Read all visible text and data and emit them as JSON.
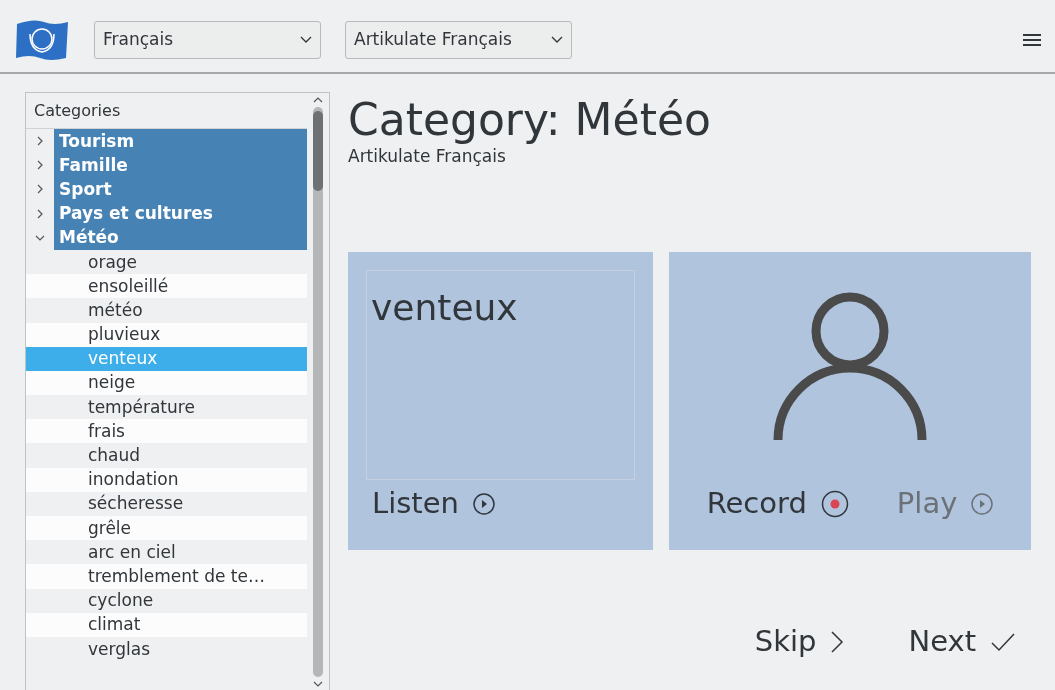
{
  "toolbar": {
    "language_select": {
      "value": "Français"
    },
    "course_select": {
      "value": "Artikulate Français"
    }
  },
  "categories": {
    "header": "Categories",
    "items": [
      {
        "label": "Tourism",
        "expanded": false
      },
      {
        "label": "Famille",
        "expanded": false
      },
      {
        "label": "Sport",
        "expanded": false
      },
      {
        "label": "Pays et cultures",
        "expanded": false
      },
      {
        "label": "Météo",
        "expanded": true,
        "children": [
          {
            "label": "orage",
            "selected": false
          },
          {
            "label": "ensoleillé",
            "selected": false
          },
          {
            "label": "météo",
            "selected": false
          },
          {
            "label": "pluvieux",
            "selected": false
          },
          {
            "label": "venteux",
            "selected": true
          },
          {
            "label": "neige",
            "selected": false
          },
          {
            "label": "température",
            "selected": false
          },
          {
            "label": "frais",
            "selected": false
          },
          {
            "label": "chaud",
            "selected": false
          },
          {
            "label": "inondation",
            "selected": false
          },
          {
            "label": "sécheresse",
            "selected": false
          },
          {
            "label": "grêle",
            "selected": false
          },
          {
            "label": "arc en ciel",
            "selected": false
          },
          {
            "label": "tremblement de te…",
            "selected": false
          },
          {
            "label": "cyclone",
            "selected": false
          },
          {
            "label": "climat",
            "selected": false
          },
          {
            "label": "verglas",
            "selected": false
          }
        ]
      }
    ]
  },
  "title": "Category: Météo",
  "subtitle": "Artikulate Français",
  "phrase_card": {
    "word": "venteux",
    "listen": "Listen"
  },
  "user_card": {
    "record": "Record",
    "play": "Play",
    "play_disabled": true
  },
  "footer": {
    "skip": "Skip",
    "next": "Next"
  }
}
